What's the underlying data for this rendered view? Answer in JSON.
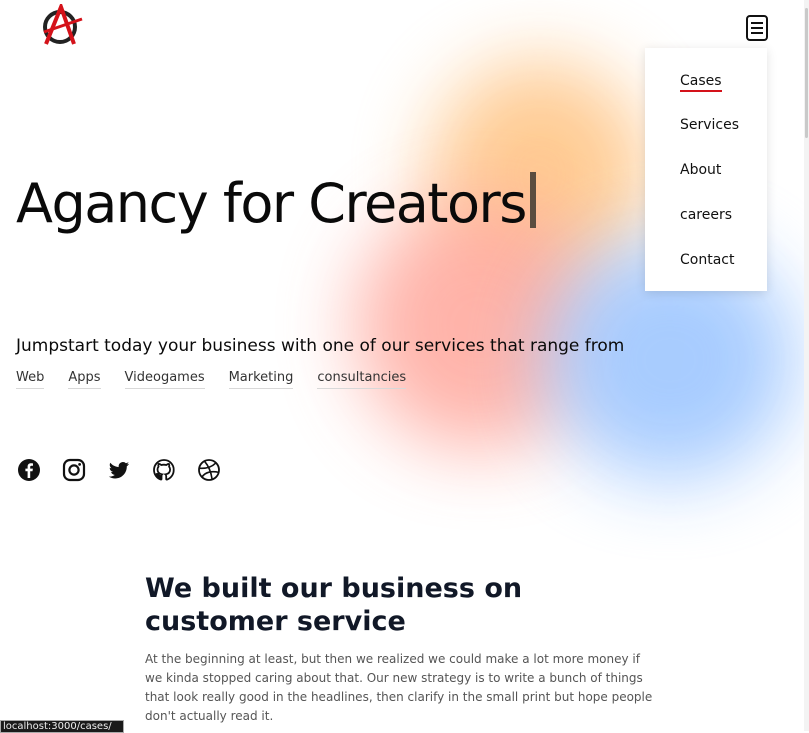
{
  "header": {
    "logo_icon": "anarchy-a-icon",
    "menu_icon": "menu-document-icon"
  },
  "nav": {
    "items": [
      {
        "label": "Cases",
        "active": true
      },
      {
        "label": "Services",
        "active": false
      },
      {
        "label": "About",
        "active": false
      },
      {
        "label": "careers",
        "active": false
      },
      {
        "label": "Contact",
        "active": false
      }
    ],
    "accent_color": "#d4121a"
  },
  "hero": {
    "title": "Agancy for Creators",
    "subtitle": "Jumpstart today your business with one of our services that range from",
    "tags": [
      "Web",
      "Apps",
      "Videogames",
      "Marketing",
      "consultancies"
    ]
  },
  "socials": [
    "facebook-icon",
    "instagram-icon",
    "twitter-icon",
    "github-icon",
    "dribbble-icon"
  ],
  "about": {
    "title": "We built our business on customer service",
    "text": "At the beginning at least, but then we realized we could make a lot more money if we kinda stopped caring about that. Our new strategy is to write a bunch of things that look really good in the headlines, then clarify in the small print but hope people don't actually read it."
  },
  "status_bar": {
    "url": "localhost:3000/cases/"
  }
}
